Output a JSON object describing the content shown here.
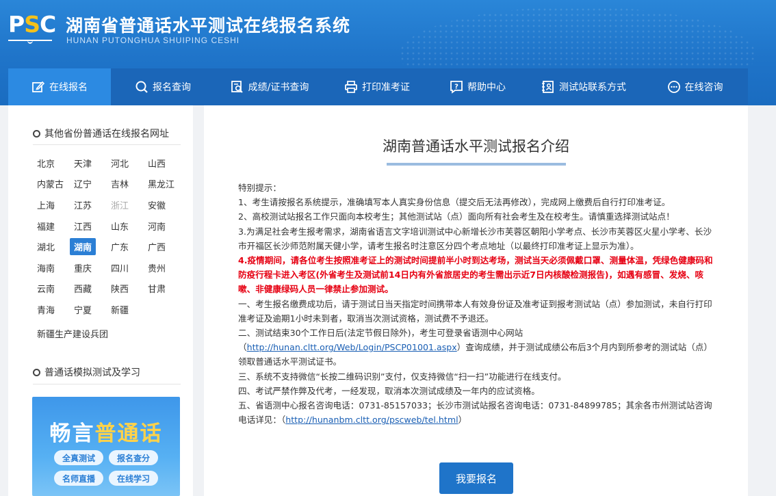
{
  "header": {
    "logo_text_p": "P",
    "logo_text_s": "S",
    "logo_text_c": "C",
    "title": "湖南省普通话水平测试在线报名系统",
    "subtitle": "HUNAN PUTONGHUA SHUIPING CESHI"
  },
  "nav": {
    "items": [
      {
        "label": "在线报名",
        "icon": "edit-icon"
      },
      {
        "label": "报名查询",
        "icon": "search-icon"
      },
      {
        "label": "成绩/证书查询",
        "icon": "document-search-icon"
      },
      {
        "label": "打印准考证",
        "icon": "printer-icon"
      },
      {
        "label": "帮助中心",
        "icon": "help-icon"
      },
      {
        "label": "测试站联系方式",
        "icon": "contact-card-icon"
      },
      {
        "label": "在线咨询",
        "icon": "chat-icon"
      }
    ],
    "active_index": 0
  },
  "sidebar": {
    "provinces_title": "其他省份普通话在线报名网址",
    "provinces": [
      "北京",
      "天津",
      "河北",
      "山西",
      "内蒙古",
      "辽宁",
      "吉林",
      "黑龙江",
      "上海",
      "江苏",
      "浙江",
      "安徽",
      "福建",
      "江西",
      "山东",
      "河南",
      "湖北",
      "湖南",
      "广东",
      "广西",
      "海南",
      "重庆",
      "四川",
      "贵州",
      "云南",
      "西藏",
      "陕西",
      "甘肃",
      "青海",
      "宁夏",
      "新疆"
    ],
    "active_province": "湖南",
    "disabled_province": "浙江",
    "extra": "新疆生产建设兵团",
    "practice_title": "普通话模拟测试及学习",
    "promo": {
      "title_part1": "畅言",
      "title_part2": "普通话",
      "pills": [
        "全真测试",
        "报名查分",
        "名师直播",
        "在线学习"
      ]
    }
  },
  "main": {
    "title": "湖南普通话水平测试报名介绍",
    "notice": {
      "intro": "特别提示：",
      "item1": "1、考生请按报名系统提示，准确填写本人真实身份信息（提交后无法再修改），完成网上缴费后自行打印准考证。",
      "item2": "2、高校测试站报名工作只面向本校考生；其他测试站（点）面向所有社会考生及在校考生。请慎重选择测试站点！",
      "item3": "3.为满足社会考生报考需求，湖南省语言文字培训测试中心新增长沙市芙蓉区朝阳小学考点、长沙市芙蓉区火星小学考、长沙市开福区长沙师范附属天健小学，请考生报名时注意区分四个考点地址（以最终打印准考证上显示为准）。",
      "item4": "4.疫情期间，请各位考生按照准考证上的测试时间提前半小时到达考场，测试当天必须佩戴口罩、测量体温，凭绿色健康码和防疫行程卡进入考区(外省考生及测试前14日内有外省旅居史的考生需出示近7日内核酸检测报告)，如遇有感冒、发烧、咳嗽、非健康绿码人员一律禁止参加测试。",
      "rule1": "一、考生报名缴费成功后，请于测试日当天指定时间携带本人有效身份证及准考证到报考测试站（点）参加测试，未自行打印准考证及逾期1小时未到者，取消当次测试资格，测试费不予退还。",
      "rule2_pre": "二、测试结束30个工作日后(法定节假日除外)，考生可登录省语测中心网站（",
      "rule2_link": "http://hunan.cltt.org/Web/Login/PSCP01001.aspx",
      "rule2_post": "）查询成绩，并于测试成绩公布后3个月内到所参考的测试站（点）领取普通话水平测试证书。",
      "rule3": "三、系统不支持微信“长按二维码识别”支付，仅支持微信“扫一扫”功能进行在线支付。",
      "rule4": "四、考试严禁作弊及代考，一经发现，取消本次测试成绩及一年内的应试资格。",
      "rule5_pre": "五、省语测中心报名咨询电话：0731-85157033；长沙市测试站报名咨询电话：0731-84899785；其余各市州测试站咨询电话详见：（",
      "rule5_link": "http://hunanbm.cltt.org/pscweb/tel.html",
      "rule5_post": "）"
    },
    "signup_button": "我要报名"
  }
}
